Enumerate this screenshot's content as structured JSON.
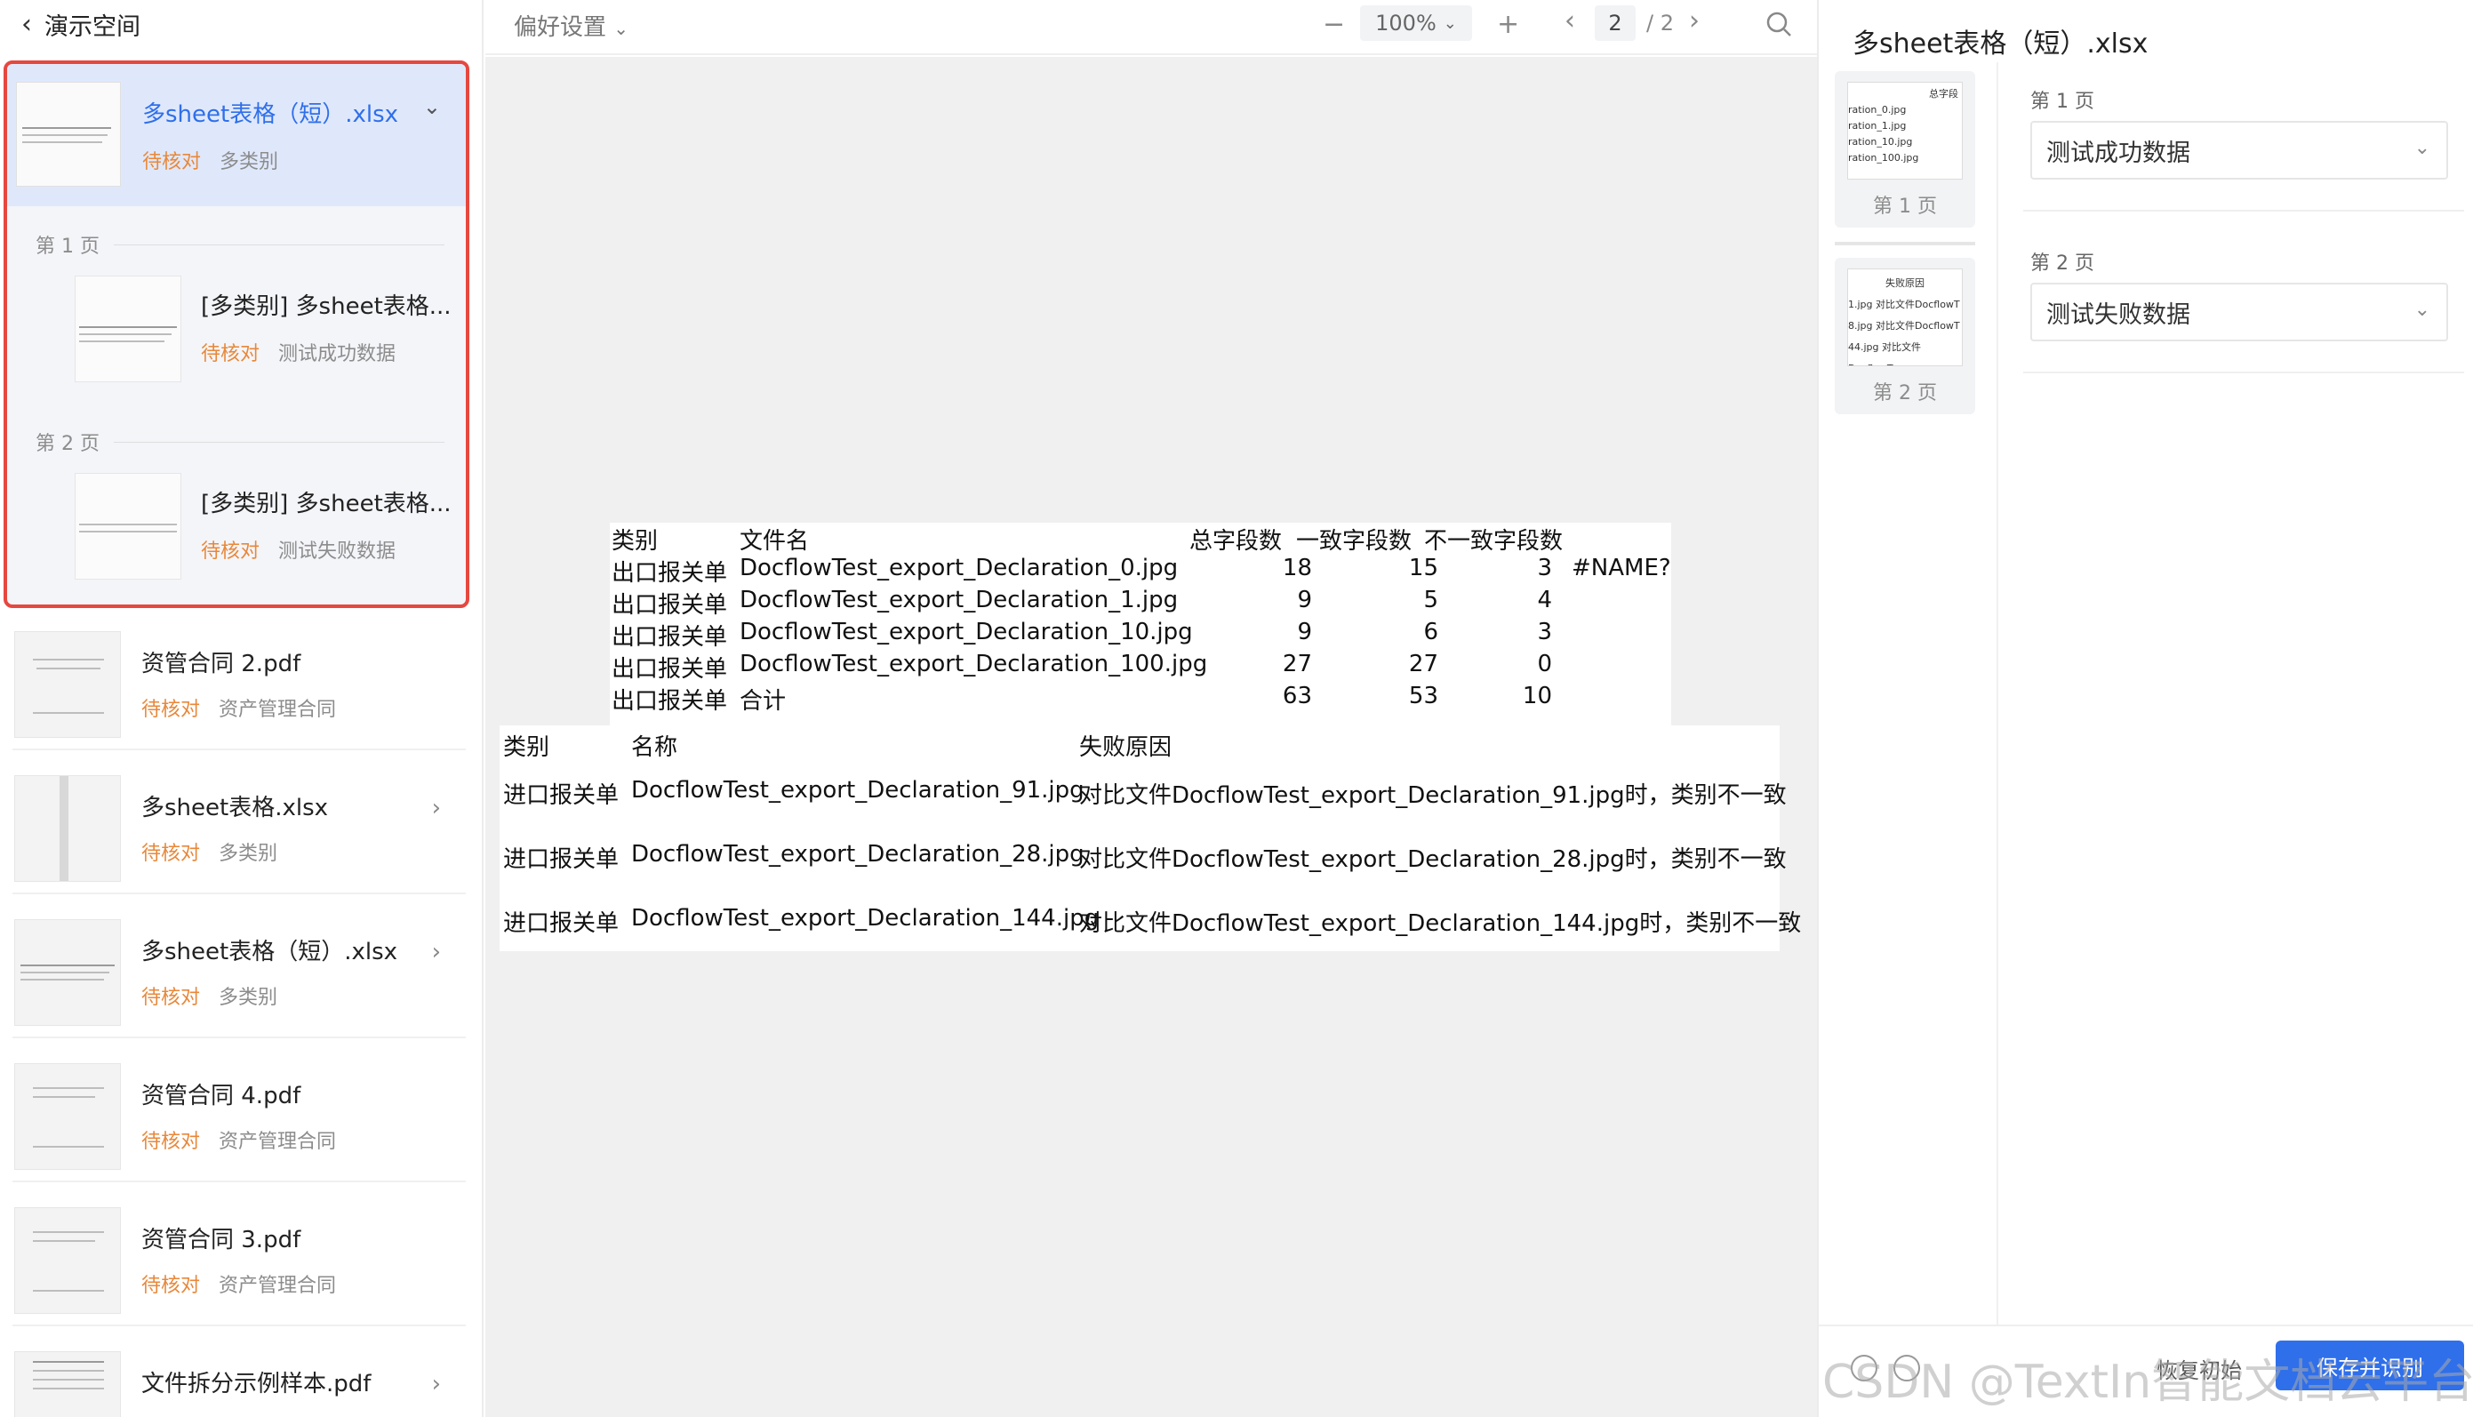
{
  "sidebar": {
    "back_label": "演示空间",
    "selected": {
      "name": "多sheet表格（短）.xlsx",
      "status": "待核对",
      "category": "多类别",
      "pages": [
        {
          "label": "第 1 页",
          "name": "[多类别] 多sheet表格...",
          "status": "待核对",
          "category": "测试成功数据"
        },
        {
          "label": "第 2 页",
          "name": "[多类别] 多sheet表格...",
          "status": "待核对",
          "category": "测试失败数据"
        }
      ]
    },
    "files": [
      {
        "name": "资管合同 2.pdf",
        "status": "待核对",
        "category": "资产管理合同",
        "chevron": ""
      },
      {
        "name": "多sheet表格.xlsx",
        "status": "待核对",
        "category": "多类别",
        "chevron": "›"
      },
      {
        "name": "多sheet表格（短）.xlsx",
        "status": "待核对",
        "category": "多类别",
        "chevron": "›"
      },
      {
        "name": "资管合同 4.pdf",
        "status": "待核对",
        "category": "资产管理合同",
        "chevron": ""
      },
      {
        "name": "资管合同 3.pdf",
        "status": "待核对",
        "category": "资产管理合同",
        "chevron": ""
      },
      {
        "name": "文件拆分示例样本.pdf",
        "status": "",
        "category": "",
        "chevron": "›"
      }
    ]
  },
  "toolbar": {
    "preferences": "偏好设置",
    "zoom_out": "−",
    "zoom": "100%",
    "zoom_in": "+",
    "prev": "‹",
    "page": "2",
    "page_total": "/ 2",
    "next": "›"
  },
  "viewer": {
    "table1": {
      "headers": [
        "类别",
        "文件名",
        "总字段数",
        "一致字段数",
        "不一致字段数"
      ],
      "rows": [
        [
          "出口报关单",
          "DocflowTest_export_Declaration_0.jpg",
          "18",
          "15",
          "3",
          "#NAME?"
        ],
        [
          "出口报关单",
          "DocflowTest_export_Declaration_1.jpg",
          "9",
          "5",
          "4",
          ""
        ],
        [
          "出口报关单",
          "DocflowTest_export_Declaration_10.jpg",
          "9",
          "6",
          "3",
          ""
        ],
        [
          "出口报关单",
          "DocflowTest_export_Declaration_100.jpg",
          "27",
          "27",
          "0",
          ""
        ],
        [
          "出口报关单",
          "合计",
          "63",
          "53",
          "10",
          ""
        ]
      ]
    },
    "table2": {
      "headers": [
        "类别",
        "名称",
        "失败原因"
      ],
      "rows": [
        [
          "进口报关单",
          "DocflowTest_export_Declaration_91.jpg",
          "对比文件DocflowTest_export_Declaration_91.jpg时，类别不一致"
        ],
        [
          "进口报关单",
          "DocflowTest_export_Declaration_28.jpg",
          "对比文件DocflowTest_export_Declaration_28.jpg时，类别不一致"
        ],
        [
          "进口报关单",
          "DocflowTest_export_Declaration_144.jpg",
          "对比文件DocflowTest_export_Declaration_144.jpg时，类别不一致"
        ]
      ]
    }
  },
  "right_panel": {
    "title": "多sheet表格（短）.xlsx",
    "thumbs": [
      {
        "label": "第 1 页",
        "lines": [
          "总字段",
          "ration_0.jpg",
          "ration_1.jpg",
          "ration_10.jpg",
          "ration_100.jpg"
        ]
      },
      {
        "label": "第 2 页",
        "lines": [
          "失败原因",
          "1.jpg  对比文件DocflowT",
          "8.jpg  对比文件DocflowT",
          "44.jpg 对比文件DocflowT"
        ]
      }
    ],
    "fields": [
      {
        "page_label": "第 1 页",
        "value": "测试成功数据"
      },
      {
        "page_label": "第 2 页",
        "value": "测试失败数据"
      }
    ],
    "footer": {
      "reset": "恢复初始",
      "save": "保存并识别"
    }
  },
  "watermark": "CSDN @TextIn智能文档云平台"
}
